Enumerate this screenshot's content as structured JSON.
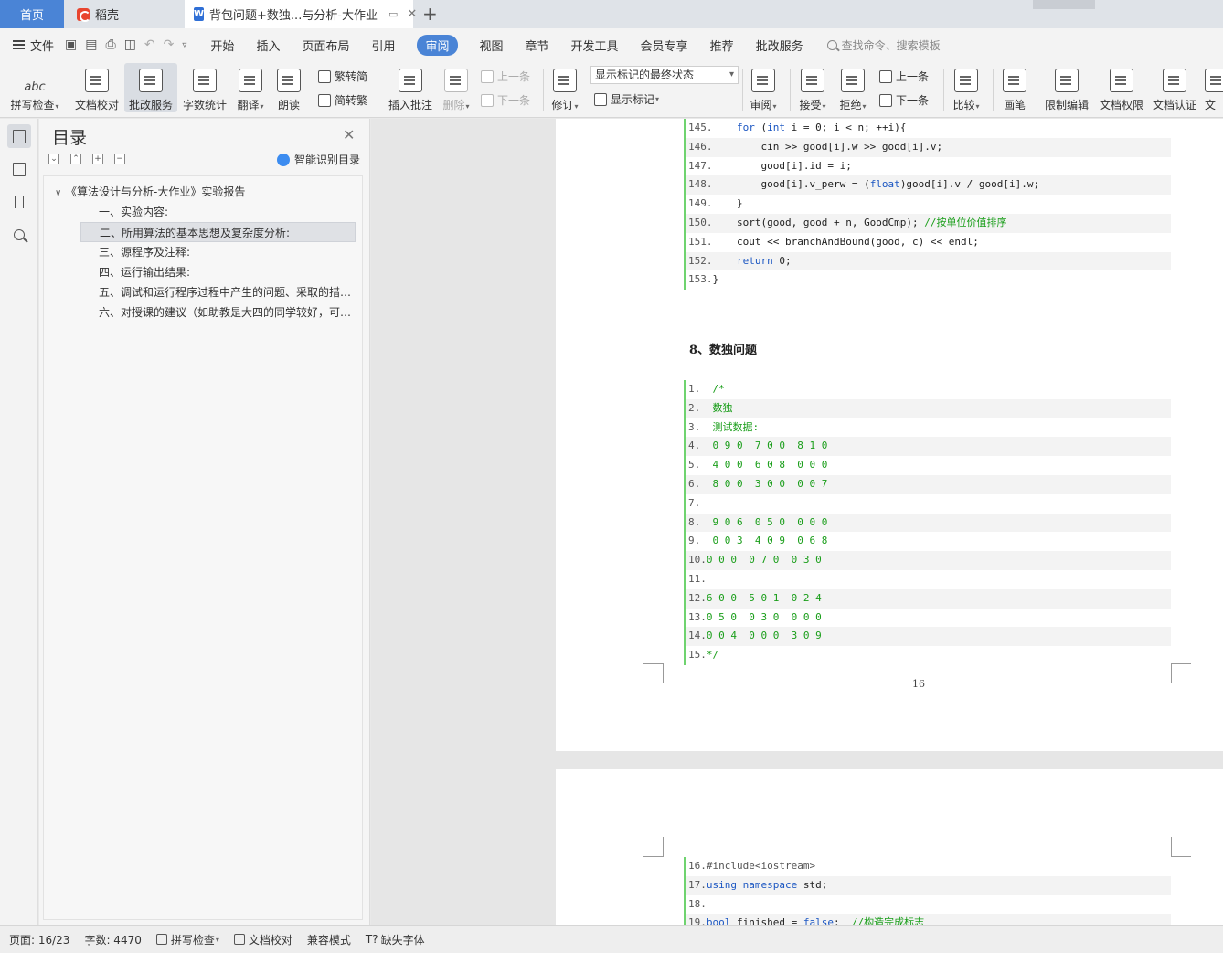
{
  "tabs": {
    "home": "首页",
    "daoke": "稻壳",
    "doc": "背包问题+数独...与分析-大作业",
    "add": "+"
  },
  "menu": {
    "file": "文件",
    "items": [
      "开始",
      "插入",
      "页面布局",
      "引用",
      "审阅",
      "视图",
      "章节",
      "开发工具",
      "会员专享",
      "推荐",
      "批改服务"
    ],
    "active": "审阅",
    "search": "查找命令、搜索模板"
  },
  "ribbon": {
    "spell": "拼写检查",
    "proof": "文档校对",
    "review_service": "批改服务",
    "word_count": "字数统计",
    "translate": "翻译",
    "read_aloud": "朗读",
    "to_simplified": "繁转简",
    "to_traditional": "简转繁",
    "insert_comment": "插入批注",
    "delete": "删除",
    "prev": "上一条",
    "next": "下一条",
    "revise": "修订",
    "markup_state": "显示标记的最终状态",
    "show_markup": "显示标记",
    "review": "审阅",
    "accept": "接受",
    "reject": "拒绝",
    "prev2": "上一条",
    "next2": "下一条",
    "compare": "比较",
    "pen": "画笔",
    "restrict": "限制编辑",
    "permission": "文档权限",
    "certify": "文档认证",
    "cut_label": "文"
  },
  "toc": {
    "title": "目录",
    "smart": "智能识别目录",
    "root": "《算法设计与分析-大作业》实验报告",
    "items": [
      "一、实验内容:",
      "二、所用算法的基本思想及复杂度分析:",
      "三、源程序及注释:",
      "四、运行输出结果:",
      "五、调试和运行程序过程中产生的问题、采取的措施及获得的相关经验教训",
      "六、对授课的建议（如助教是大四的同学较好，可以提出更多的建议）"
    ],
    "selected_index": 1
  },
  "document": {
    "code_top": [
      {
        "n": "145.",
        "parts": [
          [
            "    ",
            "d"
          ],
          [
            "for",
            "b"
          ],
          [
            " (",
            "d"
          ],
          [
            "int",
            "b"
          ],
          [
            " i = 0; i < n; ++i){",
            "d"
          ]
        ]
      },
      {
        "n": "146.",
        "parts": [
          [
            "        cin >> good[i].w >> good[i].v;",
            "d"
          ]
        ]
      },
      {
        "n": "147.",
        "parts": [
          [
            "        good[i].id = i;",
            "d"
          ]
        ]
      },
      {
        "n": "148.",
        "parts": [
          [
            "        good[i].v_perw = (",
            "d"
          ],
          [
            "float",
            "b"
          ],
          [
            ")good[i].v / good[i].w;",
            "d"
          ]
        ]
      },
      {
        "n": "149.",
        "parts": [
          [
            "    }",
            "d"
          ]
        ]
      },
      {
        "n": "150.",
        "parts": [
          [
            "    sort(good, good + n, GoodCmp); ",
            "d"
          ],
          [
            "//按单位价值排序",
            "g"
          ]
        ]
      },
      {
        "n": "151.",
        "parts": [
          [
            "    cout << branchAndBound(good, c) << endl;",
            "d"
          ]
        ]
      },
      {
        "n": "152.",
        "parts": [
          [
            "    ",
            "d"
          ],
          [
            "return",
            "b"
          ],
          [
            " 0;",
            "d"
          ]
        ]
      },
      {
        "n": "153.",
        "parts": [
          [
            "}",
            "d"
          ]
        ]
      }
    ],
    "heading": "8、数独问题",
    "code_sudoku": [
      {
        "n": "1.",
        "parts": [
          [
            "  /*",
            "g"
          ]
        ]
      },
      {
        "n": "2.",
        "parts": [
          [
            "  数独",
            "g"
          ]
        ]
      },
      {
        "n": "3.",
        "parts": [
          [
            "  测试数据:",
            "g"
          ]
        ]
      },
      {
        "n": "4.",
        "parts": [
          [
            "  0 9 0  7 0 0  8 1 0",
            "g"
          ]
        ]
      },
      {
        "n": "5.",
        "parts": [
          [
            "  4 0 0  6 0 8  0 0 0",
            "g"
          ]
        ]
      },
      {
        "n": "6.",
        "parts": [
          [
            "  8 0 0  3 0 0  0 0 7",
            "g"
          ]
        ]
      },
      {
        "n": "7.",
        "parts": [
          [
            "",
            "g"
          ]
        ]
      },
      {
        "n": "8.",
        "parts": [
          [
            "  9 0 6  0 5 0  0 0 0",
            "g"
          ]
        ]
      },
      {
        "n": "9.",
        "parts": [
          [
            "  0 0 3  4 0 9  0 6 8",
            "g"
          ]
        ]
      },
      {
        "n": "10.",
        "parts": [
          [
            "0 0 0  0 7 0  0 3 0",
            "g"
          ]
        ]
      },
      {
        "n": "11.",
        "parts": [
          [
            "",
            "g"
          ]
        ]
      },
      {
        "n": "12.",
        "parts": [
          [
            "6 0 0  5 0 1  0 2 4",
            "g"
          ]
        ]
      },
      {
        "n": "13.",
        "parts": [
          [
            "0 5 0  0 3 0  0 0 0",
            "g"
          ]
        ]
      },
      {
        "n": "14.",
        "parts": [
          [
            "0 0 4  0 0 0  3 0 9",
            "g"
          ]
        ]
      },
      {
        "n": "15.",
        "parts": [
          [
            "*/",
            "g"
          ]
        ]
      }
    ],
    "page_number": "16",
    "code_page2": [
      {
        "n": "16.",
        "parts": [
          [
            "#include<iostream>",
            "m"
          ]
        ]
      },
      {
        "n": "17.",
        "parts": [
          [
            "using",
            "b"
          ],
          [
            " ",
            "d"
          ],
          [
            "namespace",
            "b"
          ],
          [
            " std;",
            "d"
          ]
        ]
      },
      {
        "n": "18.",
        "parts": [
          [
            "",
            "d"
          ]
        ]
      },
      {
        "n": "19.",
        "parts": [
          [
            "bool",
            "b"
          ],
          [
            " finished = ",
            "d"
          ],
          [
            "false",
            "b"
          ],
          [
            ";  ",
            "d"
          ],
          [
            "//构造完成标志",
            "g"
          ]
        ]
      }
    ]
  },
  "status": {
    "page": "页面: 16/23",
    "words": "字数: 4470",
    "spell": "拼写检查",
    "proof": "文档校对",
    "compat": "兼容模式",
    "missing_font": "缺失字体"
  }
}
